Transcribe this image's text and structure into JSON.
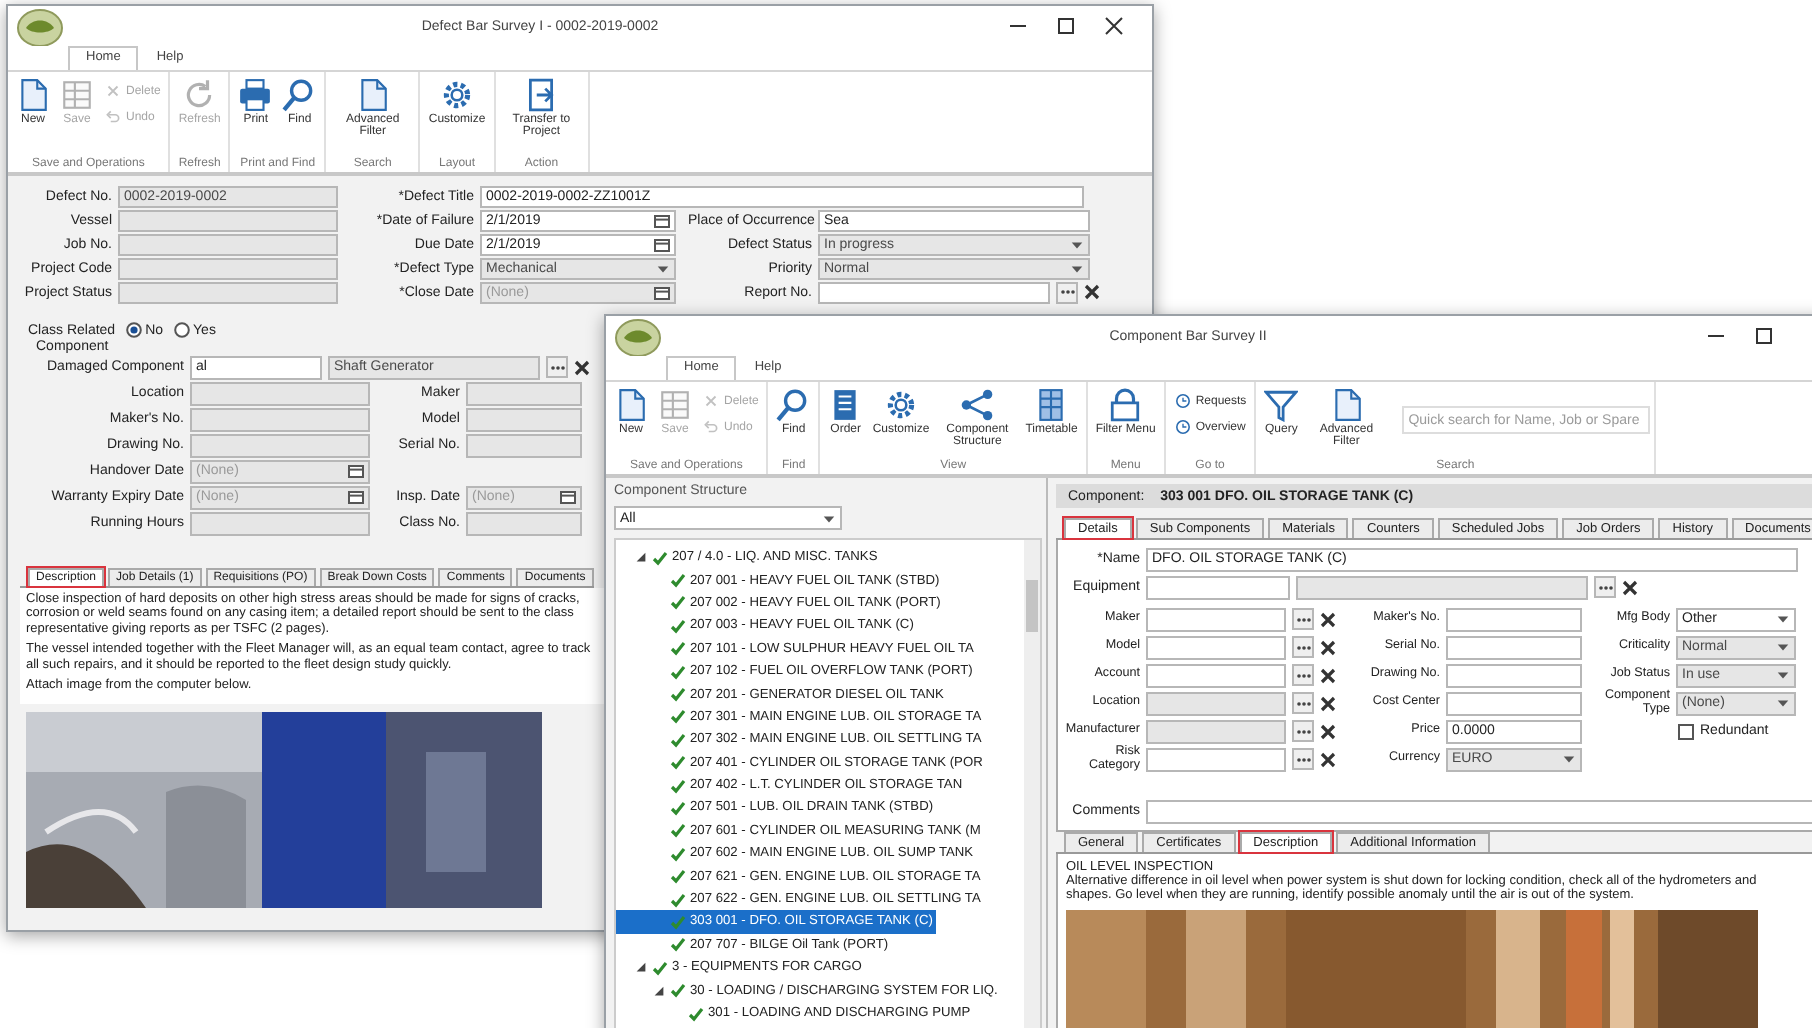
{
  "defect_window": {
    "title": "Defect Bar Survey I - 0002-2019-0002",
    "tabs": [
      {
        "label": "Home",
        "selected": true
      },
      {
        "label": "Help",
        "selected": false
      }
    ],
    "ribbon": [
      {
        "label": "Save and Operations",
        "buttons": [
          {
            "label": "New",
            "kind": "large",
            "disabled": false
          },
          {
            "label": "Save",
            "kind": "large",
            "disabled": true
          },
          {
            "label": "Delete",
            "kind": "small",
            "disabled": true
          },
          {
            "label": "Undo",
            "kind": "small",
            "disabled": true
          }
        ]
      },
      {
        "label": "Refresh",
        "buttons": [
          {
            "label": "Refresh",
            "kind": "large",
            "disabled": true
          }
        ]
      },
      {
        "label": "Print and Find",
        "buttons": [
          {
            "label": "Print",
            "kind": "large",
            "disabled": false
          },
          {
            "label": "Find",
            "kind": "large",
            "disabled": false
          }
        ]
      },
      {
        "label": "Search",
        "buttons": [
          {
            "label": "Advanced Filter",
            "kind": "large",
            "disabled": false
          }
        ]
      },
      {
        "label": "Layout",
        "buttons": [
          {
            "label": "Customize",
            "kind": "large",
            "disabled": false
          }
        ]
      },
      {
        "label": "Action",
        "buttons": [
          {
            "label": "Transfer to Project",
            "kind": "large",
            "disabled": false
          }
        ]
      }
    ],
    "header_fields": {
      "left": [
        {
          "label": "Defect No.",
          "value": "0002-2019-0002",
          "kind": "text",
          "disabled": true
        },
        {
          "label": "Vessel",
          "kind": "text",
          "disabled": true
        },
        {
          "label": "Job No.",
          "kind": "text",
          "disabled": true
        },
        {
          "label": "Project Code",
          "kind": "text",
          "disabled": true
        },
        {
          "label": "Project Status",
          "kind": "text",
          "disabled": true
        }
      ],
      "title": {
        "label": "*Defect Title",
        "value": "0002-2019-0002-ZZ1001Z",
        "kind": "text",
        "disabled": false
      },
      "middle": [
        {
          "label": "*Date of Failure",
          "value": "2/1/2019",
          "kind": "date",
          "disabled": false
        },
        {
          "label": "Due Date",
          "value": "2/1/2019",
          "kind": "date",
          "disabled": false
        },
        {
          "label": "*Defect Type",
          "value": "Mechanical",
          "kind": "combo",
          "disabled": true
        },
        {
          "label": "*Close Date",
          "placeholder": "(None)",
          "kind": "date",
          "disabled": true
        }
      ],
      "right": [
        {
          "label": "Place of Occurrence",
          "value": "Sea",
          "kind": "text",
          "disabled": false
        },
        {
          "label": "Defect Status",
          "value": "In progress",
          "kind": "combo",
          "disabled": true
        },
        {
          "label": "Priority",
          "value": "Normal",
          "kind": "combo",
          "disabled": true
        },
        {
          "label": "Report No.",
          "kind": "lookup",
          "disabled": false
        }
      ]
    },
    "class_related": {
      "label": "Class Related",
      "options": [
        {
          "label": "No",
          "selected": true
        },
        {
          "label": "Yes",
          "selected": false
        }
      ]
    },
    "component": {
      "label": "Component",
      "damaged": {
        "label": "Damaged Component",
        "value": "al",
        "description": "Shaft Generator"
      },
      "rows": [
        [
          {
            "label": "Location",
            "kind": "text",
            "disabled": true
          },
          {
            "label": "Maker",
            "kind": "text",
            "disabled": true
          }
        ],
        [
          {
            "label": "Maker's No.",
            "kind": "text",
            "disabled": true
          },
          {
            "label": "Model",
            "kind": "text",
            "disabled": true
          }
        ],
        [
          {
            "label": "Drawing No.",
            "kind": "text",
            "disabled": true
          },
          {
            "label": "Serial No.",
            "kind": "text",
            "disabled": true
          }
        ],
        [
          {
            "label": "Handover Date",
            "placeholder": "(None)",
            "kind": "date",
            "disabled": true
          }
        ],
        [
          {
            "label": "Warranty Expiry Date",
            "placeholder": "(None)",
            "kind": "date",
            "disabled": true
          },
          {
            "label": "Insp. Date",
            "placeholder": "(None)",
            "kind": "date",
            "disabled": true
          }
        ],
        [
          {
            "label": "Running Hours",
            "kind": "text",
            "disabled": true
          },
          {
            "label": "Class No.",
            "kind": "text",
            "disabled": true
          }
        ]
      ]
    },
    "detail_tabs": [
      {
        "label": "Description",
        "selected": true
      },
      {
        "label": "Job Details (1)",
        "selected": false
      },
      {
        "label": "Requisitions (PO)",
        "selected": false
      },
      {
        "label": "Break Down Costs",
        "selected": false
      },
      {
        "label": "Comments",
        "selected": false
      },
      {
        "label": "Documents",
        "selected": false
      }
    ],
    "description": [
      "Close inspection of hard deposits on other high stress areas should be made for signs of cracks, corrosion or weld seams found on any casing item; a detailed report should be sent to the class representative giving reports as per TSFC (2 pages).",
      "The vessel intended together with the Fleet Manager will, as an equal team contact, agree to track all such repairs, and it should be reported to the fleet design study quickly.",
      "Attach image from the computer below."
    ]
  },
  "component_window": {
    "title": "Component Bar Survey II",
    "tabs": [
      {
        "label": "Home",
        "selected": true
      },
      {
        "label": "Help",
        "selected": false
      }
    ],
    "ribbon": [
      {
        "label": "Save and Operations",
        "buttons": [
          {
            "label": "New",
            "kind": "large",
            "disabled": false
          },
          {
            "label": "Save",
            "kind": "large",
            "disabled": true
          },
          {
            "label": "Delete",
            "kind": "small",
            "disabled": true
          },
          {
            "label": "Undo",
            "kind": "small",
            "disabled": true
          }
        ]
      },
      {
        "label": "Find",
        "buttons": [
          {
            "label": "Find",
            "kind": "large",
            "disabled": false
          }
        ]
      },
      {
        "label": "View",
        "buttons": [
          {
            "label": "Order",
            "kind": "large",
            "disabled": false
          },
          {
            "label": "Customize",
            "kind": "large",
            "disabled": false
          },
          {
            "label": "Component Structure",
            "kind": "large",
            "disabled": false
          },
          {
            "label": "Timetable",
            "kind": "large",
            "disabled": false
          }
        ]
      },
      {
        "label": "Menu",
        "buttons": [
          {
            "label": "Filter Menu",
            "kind": "large",
            "disabled": false
          }
        ]
      },
      {
        "label": "Go to",
        "buttons": [
          {
            "label": "Requests",
            "kind": "small",
            "disabled": false
          },
          {
            "label": "Overview",
            "kind": "small",
            "disabled": false
          }
        ]
      },
      {
        "label": "Search",
        "buttons": [
          {
            "label": "Query",
            "kind": "large",
            "disabled": false
          },
          {
            "label": "Advanced Filter",
            "kind": "large",
            "disabled": false
          }
        ],
        "search": {
          "placeholder": "Quick search for Name, Job or Spare"
        }
      }
    ],
    "structure": {
      "title": "Component Structure",
      "filter": "All",
      "tree": [
        {
          "label": "207 / 4.0 - LIQ. AND MISC. TANKS",
          "expanded": true,
          "selected": false,
          "children": [
            {
              "label": "207 001 - HEAVY FUEL OIL TANK (STBD)",
              "selected": false
            },
            {
              "label": "207 002 - HEAVY FUEL OIL TANK (PORT)",
              "selected": false
            },
            {
              "label": "207 003 - HEAVY FUEL OIL TANK (C)",
              "selected": false
            },
            {
              "label": "207 101 - LOW SULPHUR HEAVY FUEL OIL TA",
              "selected": false
            },
            {
              "label": "207 102 - FUEL OIL OVERFLOW TANK (PORT)",
              "selected": false
            },
            {
              "label": "207 201 - GENERATOR DIESEL OIL TANK",
              "selected": false
            },
            {
              "label": "207 301 - MAIN ENGINE LUB. OIL STORAGE TA",
              "selected": false
            },
            {
              "label": "207 302 - MAIN ENGINE LUB. OIL SETTLING TA",
              "selected": false
            },
            {
              "label": "207 401 - CYLINDER OIL STORAGE TANK (POR",
              "selected": false
            },
            {
              "label": "207 402 - L.T. CYLINDER OIL STORAGE TAN",
              "selected": false
            },
            {
              "label": "207 501 - LUB. OIL DRAIN TANK (STBD)",
              "selected": false
            },
            {
              "label": "207 601 - CYLINDER OIL MEASURING TANK (M",
              "selected": false
            },
            {
              "label": "207 602 - MAIN ENGINE LUB. OIL SUMP TANK",
              "selected": false
            },
            {
              "label": "207 621 - GEN. ENGINE LUB. OIL STORAGE TA",
              "selected": false
            },
            {
              "label": "207 622 - GEN. ENGINE LUB. OIL SETTLING TA",
              "selected": false
            },
            {
              "label": "303 001 - DFO. OIL STORAGE TANK (C)",
              "selected": true
            },
            {
              "label": "207 707 - BILGE Oil Tank (PORT)",
              "selected": false
            }
          ]
        },
        {
          "label": "3 - EQUIPMENTS FOR CARGO",
          "expanded": true,
          "selected": false,
          "children": [
            {
              "label": "30 - LOADING / DISCHARGING SYSTEM FOR LIQ.",
              "expanded": true,
              "selected": false,
              "children": [
                {
                  "label": "301 - LOADING AND DISCHARGING PUMP",
                  "selected": false
                }
              ]
            }
          ]
        }
      ]
    },
    "component": {
      "label": "Component:",
      "value": "303 001 DFO. OIL STORAGE TANK (C)"
    },
    "detail_tabs": [
      {
        "label": "Details",
        "selected": true
      },
      {
        "label": "Sub Components",
        "selected": false
      },
      {
        "label": "Materials",
        "selected": false
      },
      {
        "label": "Counters",
        "selected": false
      },
      {
        "label": "Scheduled Jobs",
        "selected": false
      },
      {
        "label": "Job Orders",
        "selected": false
      },
      {
        "label": "History",
        "selected": false
      },
      {
        "label": "Documents",
        "selected": false
      }
    ],
    "name_field": {
      "label": "*Name",
      "value": "DFO. OIL STORAGE TANK (C)",
      "kind": "text",
      "disabled": false
    },
    "equipment": {
      "label": "Equipment",
      "kind": "lookup",
      "disabled": true
    },
    "columns": [
      [
        {
          "label": "Maker",
          "kind": "lookup",
          "disabled": false
        },
        {
          "label": "Model",
          "kind": "lookup",
          "disabled": false
        },
        {
          "label": "Account",
          "kind": "lookup",
          "disabled": false
        },
        {
          "label": "Location",
          "kind": "lookup",
          "disabled": true
        },
        {
          "label": "Manufacturer",
          "kind": "lookup",
          "disabled": true
        },
        {
          "label": "Risk Category",
          "kind": "lookup",
          "disabled": false
        }
      ],
      [
        {
          "label": "Maker's No.",
          "kind": "text",
          "disabled": false
        },
        {
          "label": "Serial No.",
          "kind": "text",
          "disabled": false
        },
        {
          "label": "Drawing No.",
          "kind": "text",
          "disabled": false
        },
        {
          "label": "Cost Center",
          "kind": "text",
          "disabled": false
        },
        {
          "label": "Price",
          "value": "0.0000",
          "kind": "text",
          "disabled": false
        },
        {
          "label": "Currency",
          "value": "EURO",
          "kind": "combo",
          "disabled": true
        }
      ],
      [
        {
          "label": "Mfg Body",
          "value": "Other",
          "kind": "combo",
          "disabled": false
        },
        {
          "label": "Criticality",
          "value": "Normal",
          "kind": "combo",
          "disabled": true
        },
        {
          "label": "Job Status",
          "value": "In use",
          "kind": "combo",
          "disabled": true
        },
        {
          "label": "Component Type",
          "value": "(None)",
          "kind": "combo",
          "disabled": true
        }
      ]
    ],
    "redundant": {
      "label": "Redundant",
      "checked": false
    },
    "comments": {
      "label": "Comments",
      "kind": "text",
      "disabled": false
    },
    "subtabs": [
      {
        "label": "General",
        "selected": false
      },
      {
        "label": "Certificates",
        "selected": false
      },
      {
        "label": "Description",
        "selected": true
      },
      {
        "label": "Additional Information",
        "selected": false
      }
    ],
    "description": {
      "heading": "OIL LEVEL INSPECTION",
      "text": "Alternative difference in oil level when power system is shut down for locking condition, check all of the hydrometers and shapes. Go level when they are running, identify possible anomaly until the air is out of the system."
    }
  }
}
